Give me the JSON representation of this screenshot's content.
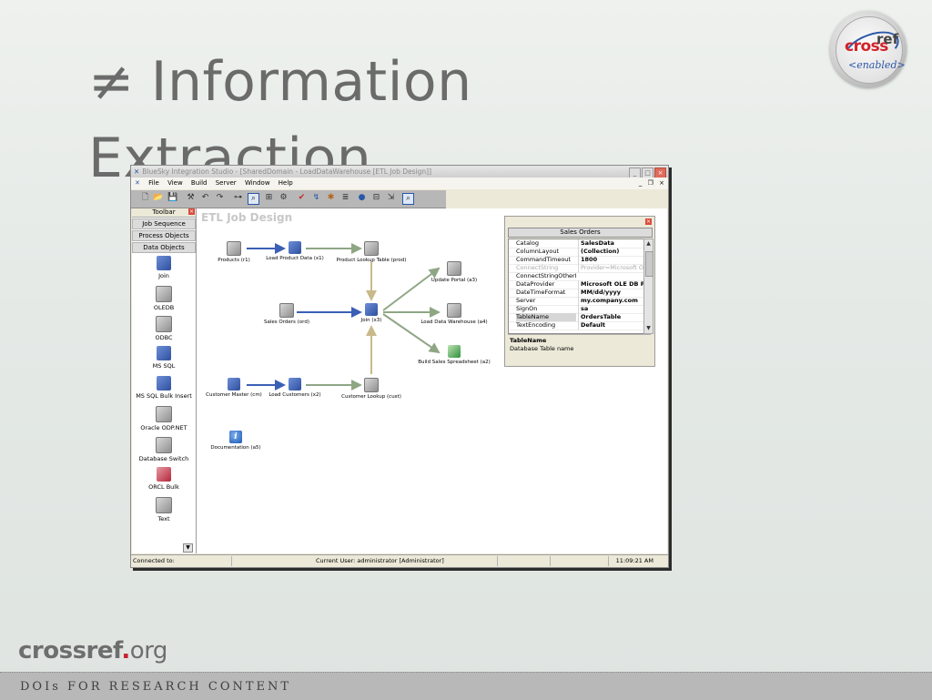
{
  "slide": {
    "title_symbol": "≠",
    "title_line1": "Information",
    "title_line2": "Extraction",
    "footer_logo_main": "crossref",
    "footer_logo_dot": ".",
    "footer_logo_suffix": "org",
    "footer_tagline": "DOIs FOR RESEARCH CONTENT",
    "badge": {
      "cross": "cross",
      "ref": "ref",
      "enabled": "<enabled>"
    },
    "colors": {
      "crossref_red": "#c8202f",
      "badge_blue": "#2a57a8"
    }
  },
  "app": {
    "window_title": "BlueSky Integration Studio - [SharedDomain - LoadDataWarehouse [ETL Job Design]]",
    "menu": [
      "File",
      "View",
      "Build",
      "Server",
      "Window",
      "Help"
    ],
    "mdi_controls": [
      "_",
      "❐",
      "×"
    ],
    "toolbar_icons": [
      "new-icon",
      "open-icon",
      "save-icon",
      "build-icon",
      "undo-icon",
      "redo-icon",
      "link-icon",
      "zoom-icon",
      "properties-icon",
      "tools-icon",
      "check-icon",
      "run-icon",
      "debug-icon",
      "list-icon",
      "point-icon",
      "grid-icon",
      "export-icon",
      "search-icon"
    ],
    "sidebar": {
      "header": "Toolbar",
      "tabs": [
        "Job Sequence",
        "Process Objects",
        "Data Objects"
      ],
      "items": [
        "Join",
        "OLEDB",
        "ODBC",
        "MS SQL",
        "MS SQL Bulk Insert",
        "Oracle ODP.NET",
        "Database Switch",
        "ORCL Bulk",
        "Text"
      ]
    },
    "canvas": {
      "title": "ETL Job Design",
      "nodes": {
        "products": "Products (r1)",
        "load_product_data": "Load Product Data (x1)",
        "product_lookup": "Product Lookup Table (prod)",
        "sales_orders": "Sales Orders (ord)",
        "join": "Join (x3)",
        "update_portal": "Update Portal (a3)",
        "load_dw": "Load Data Warehouse (a4)",
        "build_sales": "Build Sales Spreadsheet (a2)",
        "customer_master": "Customer Master (cm)",
        "load_customers": "Load Customers (x2)",
        "customer_lookup": "Customer Lookup (cust)",
        "documentation": "Documentation (a5)"
      }
    },
    "properties": {
      "header": "Sales Orders",
      "rows": [
        {
          "key": "Catalog",
          "value": "SalesData"
        },
        {
          "key": "ColumnLayout",
          "value": "(Collection)"
        },
        {
          "key": "CommandTimeout",
          "value": "1800"
        },
        {
          "key": "ConnectString",
          "value": "Provider=Microsoft OLE DB"
        },
        {
          "key": "ConnectStringOtherPa",
          "value": ""
        },
        {
          "key": "DataProvider",
          "value": "Microsoft OLE DB Prov"
        },
        {
          "key": "DateTimeFormat",
          "value": "MM/dd/yyyy"
        },
        {
          "key": "Server",
          "value": "my.company.com"
        },
        {
          "key": "SignOn",
          "value": "sa"
        },
        {
          "key": "TableName",
          "value": "OrdersTable"
        },
        {
          "key": "TextEncoding",
          "value": "Default"
        }
      ],
      "selected_key": "TableName",
      "desc_title": "TableName",
      "desc_text": "Database Table name"
    },
    "status": {
      "connected": "Connected to:",
      "user": "Current User: administrator [Administrator]",
      "time": "11:09:21 AM"
    },
    "colors": {
      "flow_blue": "#3a5fb5",
      "flow_green": "#8fa685",
      "flow_tan": "#c9b98a"
    }
  }
}
